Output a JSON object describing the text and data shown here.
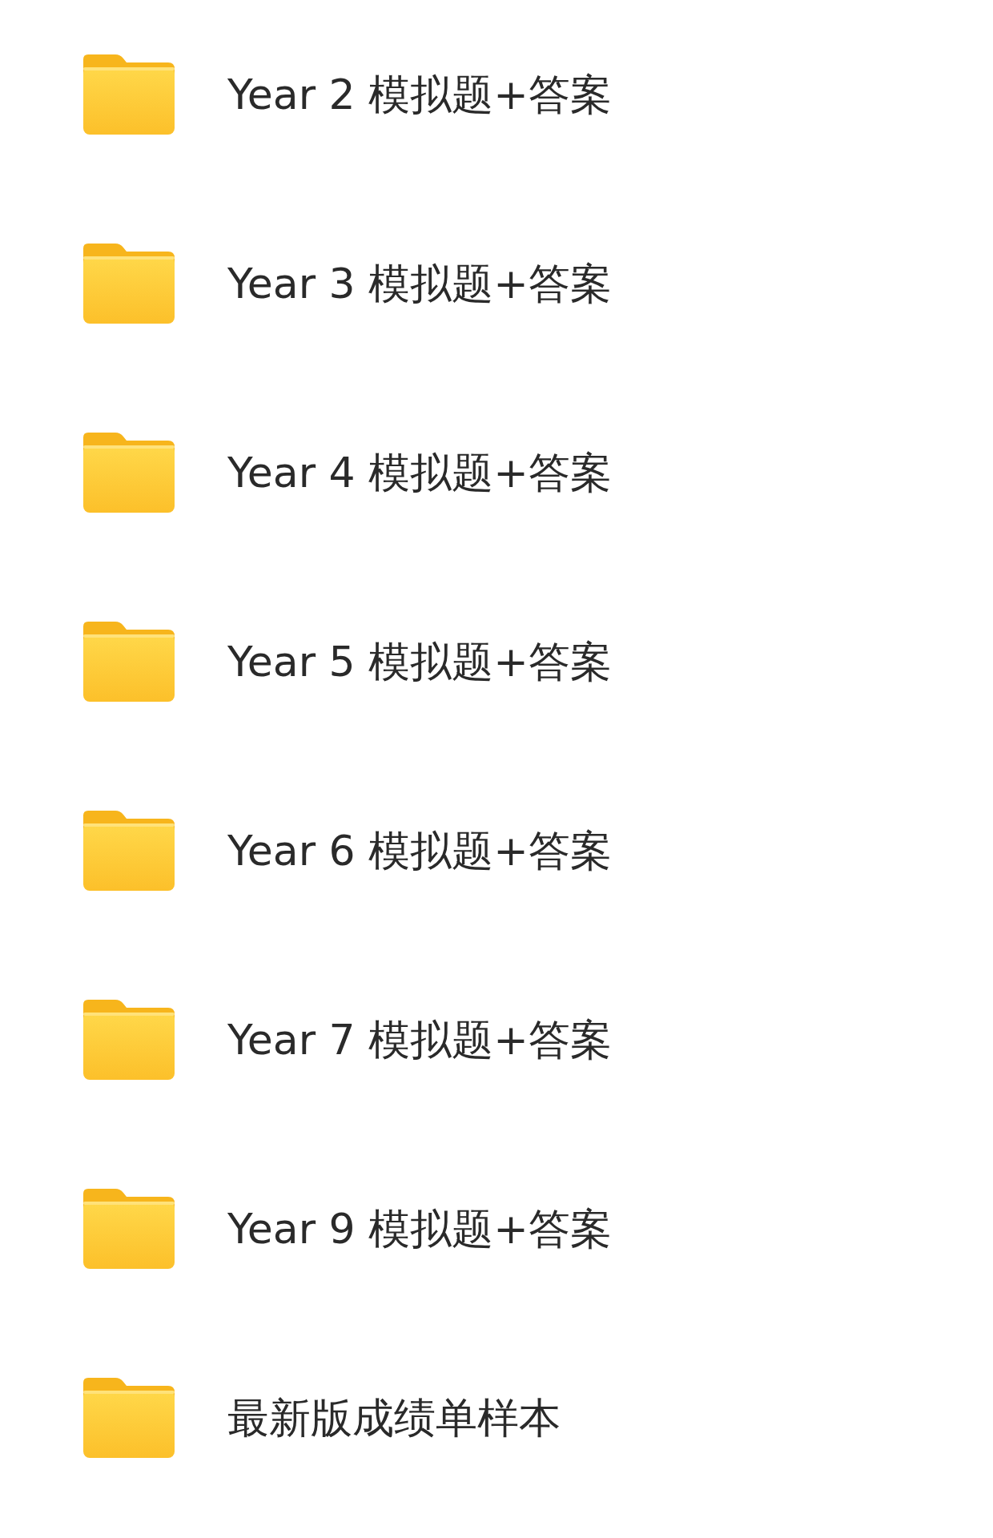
{
  "folders": [
    {
      "name": "Year 2 模拟题+答案"
    },
    {
      "name": "Year 3 模拟题+答案"
    },
    {
      "name": "Year 4 模拟题+答案"
    },
    {
      "name": "Year 5 模拟题+答案"
    },
    {
      "name": "Year 6 模拟题+答案"
    },
    {
      "name": "Year 7 模拟题+答案"
    },
    {
      "name": "Year 9 模拟题+答案"
    },
    {
      "name": "最新版成绩单样本"
    }
  ]
}
